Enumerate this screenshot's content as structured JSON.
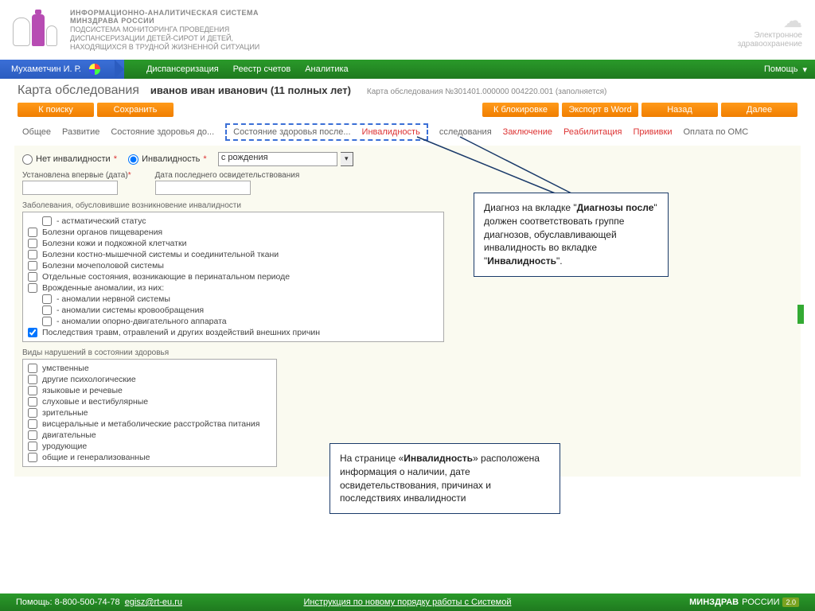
{
  "header": {
    "line1": "ИНФОРМАЦИОННО-АНАЛИТИЧЕСКАЯ СИСТЕМА",
    "line2": "МИНЗДРАВА РОССИИ",
    "line3": "ПОДСИСТЕМА МОНИТОРИНГА ПРОВЕДЕНИЯ",
    "line4": "ДИСПАНСЕРИЗАЦИИ ДЕТЕЙ-СИРОТ И ДЕТЕЙ,",
    "line5": "НАХОДЯЩИХСЯ В ТРУДНОЙ ЖИЗНЕННОЙ СИТУАЦИИ",
    "brand_r1": "Электронное",
    "brand_r2": "здравоохранение"
  },
  "nav": {
    "user": "Мухаметчин И. Р.",
    "items": [
      "Диспансеризация",
      "Реестр счетов",
      "Аналитика"
    ],
    "help": "Помощь"
  },
  "title": {
    "page": "Карта обследования",
    "patient": "иванов иван иванович (11 полных лет)",
    "cardno": "Карта обследования №301401.000000 004220.001",
    "status": "(заполняется)"
  },
  "buttons": {
    "search": "К поиску",
    "save": "Сохранить",
    "block": "К блокировке",
    "export": "Экспорт в Word",
    "back": "Назад",
    "next": "Далее"
  },
  "tabs": {
    "t1": "Общее",
    "t2": "Развитие",
    "t3": "Состояние здоровья до...",
    "t4": "Состояние здоровья после...",
    "t5": "Инвалидность",
    "t6": "сследования",
    "t7": "Заключение",
    "t8": "Реабилитация",
    "t9": "Прививки",
    "t10": "Оплата по ОМС"
  },
  "form": {
    "no_inv": "Нет инвалидности",
    "inv": "Инвалидность",
    "since": "с рождения",
    "date1_lbl": "Установлена впервые (дата)",
    "date2_lbl": "Дата последнего освидетельствования",
    "sec1": "Заболевания, обусловившие возникновение инвалидности",
    "diseases": [
      "- астматический статус",
      "Болезни органов пищеварения",
      "Болезни кожи и подкожной клетчатки",
      "Болезни костно-мышечной системы и соединительной ткани",
      "Болезни мочеполовой системы",
      "Отдельные состояния, возникающие в перинатальном периоде",
      "Врожденные аномалии, из них:",
      "- аномалии нервной системы",
      "- аномалии системы кровообращения",
      "- аномалии опорно-двигательного аппарата",
      "Последствия травм, отравлений и других воздействий внешних причин"
    ],
    "sec2": "Виды нарушений в состоянии здоровья",
    "violations": [
      "умственные",
      "другие психологические",
      "языковые и речевые",
      "слуховые и вестибулярные",
      "зрительные",
      "висцеральные и метаболические расстройства питания",
      "двигательные",
      "уродующие",
      "общие и генерализованные"
    ]
  },
  "callouts": {
    "c1_p1": "Диагноз на вкладке \"",
    "c1_b1": "Диагнозы после",
    "c1_p2": "\" должен соответствовать группе диагнозов, обуславливающей инвалидность во вкладке \"",
    "c1_b2": "Инвалидность",
    "c1_p3": "\".",
    "c2_p1": "На странице «",
    "c2_b1": "Инвалидность",
    "c2_p2": "» расположена информация о наличии, дате освидетельствования, причинах и последствиях инвалидности"
  },
  "footer": {
    "help": "Помощь:",
    "phone": "8-800-500-74-78",
    "email": "egisz@rt-eu.ru",
    "instr": "Инструкция по новому порядку работы с Системой",
    "min": "МИНЗДРАВ",
    "ros": "РОССИИ",
    "ver": "2.0"
  }
}
